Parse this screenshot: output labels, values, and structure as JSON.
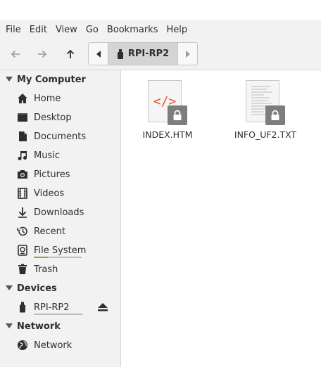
{
  "menubar": [
    "File",
    "Edit",
    "View",
    "Go",
    "Bookmarks",
    "Help"
  ],
  "toolbar": {
    "back_icon": "arrow-left-icon",
    "forward_icon": "arrow-right-icon",
    "up_icon": "arrow-up-icon"
  },
  "pathbar": {
    "current": "RPI-RP2"
  },
  "sidebar": {
    "my_computer": {
      "header": "My Computer",
      "items": [
        {
          "label": "Home",
          "icon": "home-icon"
        },
        {
          "label": "Desktop",
          "icon": "desktop-icon"
        },
        {
          "label": "Documents",
          "icon": "document-icon"
        },
        {
          "label": "Music",
          "icon": "music-icon"
        },
        {
          "label": "Pictures",
          "icon": "camera-icon"
        },
        {
          "label": "Videos",
          "icon": "film-icon"
        },
        {
          "label": "Downloads",
          "icon": "download-icon"
        },
        {
          "label": "Recent",
          "icon": "history-icon"
        },
        {
          "label": "File System",
          "icon": "harddisk-icon"
        },
        {
          "label": "Trash",
          "icon": "trash-icon"
        }
      ]
    },
    "devices": {
      "header": "Devices",
      "items": [
        {
          "label": "RPI-RP2",
          "icon": "usb-drive-icon"
        }
      ]
    },
    "network": {
      "header": "Network",
      "items": [
        {
          "label": "Network",
          "icon": "globe-icon"
        }
      ]
    }
  },
  "files": [
    {
      "name": "INDEX.HTM",
      "type": "html",
      "locked": true
    },
    {
      "name": "INFO_UF2.TXT",
      "type": "text",
      "locked": true
    }
  ],
  "colors": {
    "html_accent": "#e95420",
    "lock_bg": "#7d7d7d",
    "sidebar_bg": "#f2f2f2"
  }
}
